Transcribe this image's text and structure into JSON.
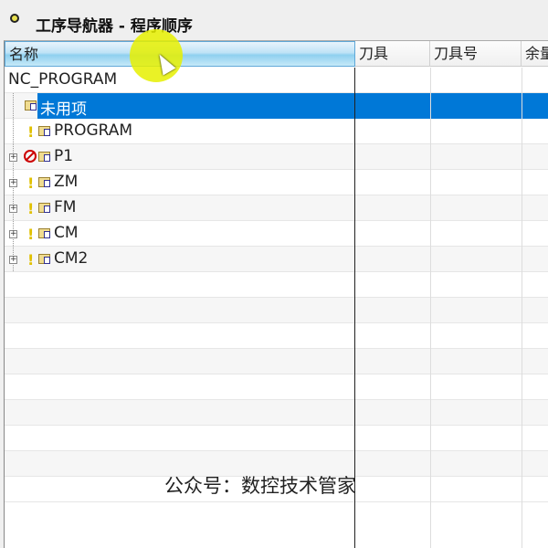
{
  "title": "工序导航器 - 程序顺序",
  "columns": [
    "名称",
    "刀具",
    "刀具号",
    "余量"
  ],
  "rows": [
    {
      "label": "NC_PROGRAM",
      "status": "none",
      "expand": false
    },
    {
      "label": "未用项",
      "status": "none",
      "expand": false,
      "selected": true
    },
    {
      "label": "PROGRAM",
      "status": "warning",
      "expand": false
    },
    {
      "label": "P1",
      "status": "blocked",
      "expand": true
    },
    {
      "label": "ZM",
      "status": "warning",
      "expand": true
    },
    {
      "label": "FM",
      "status": "warning",
      "expand": true
    },
    {
      "label": "CM",
      "status": "warning",
      "expand": true
    },
    {
      "label": "CM2",
      "status": "warning",
      "expand": true
    }
  ],
  "watermark": "公众号：数控技术管家",
  "colors": {
    "selection": "#0078d7",
    "warning": "#e0c000",
    "blocked": "#cc0000"
  }
}
